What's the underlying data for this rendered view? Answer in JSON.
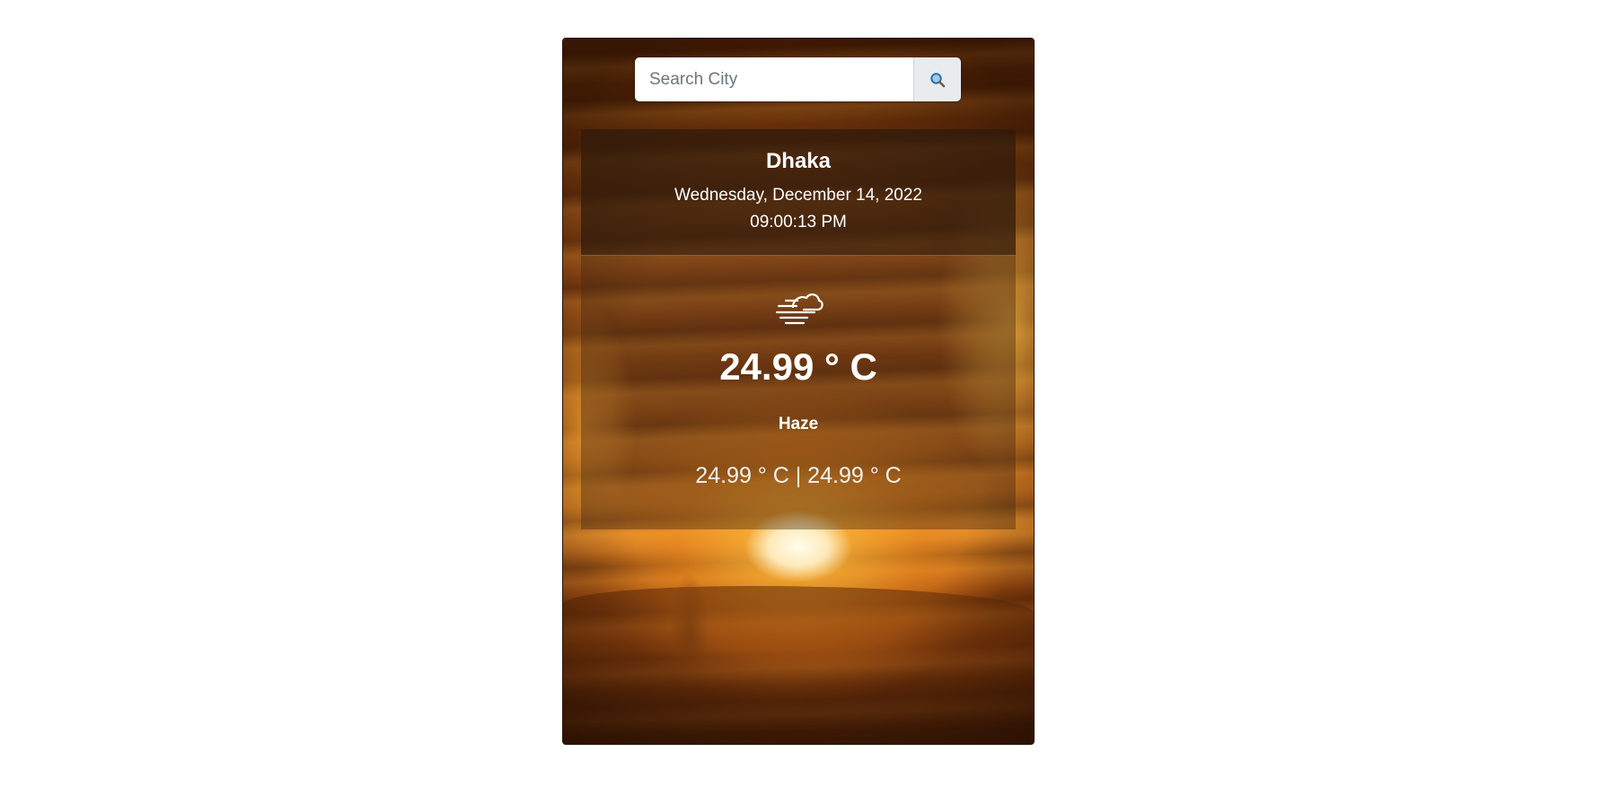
{
  "search": {
    "placeholder": "Search City",
    "value": "",
    "button_icon": "search-icon"
  },
  "weather": {
    "city": "Dhaka",
    "date": "Wednesday, December 14, 2022",
    "time": "09:00:13 PM",
    "icon": "haze-wind-cloud-icon",
    "temperature": "24.99 ° C",
    "condition": "Haze",
    "min_max": "24.99 ° C | 24.99 ° C"
  },
  "colors": {
    "search_button_bg": "#e9ecef",
    "text": "#ffffff",
    "page_bg": "#ffffff"
  }
}
